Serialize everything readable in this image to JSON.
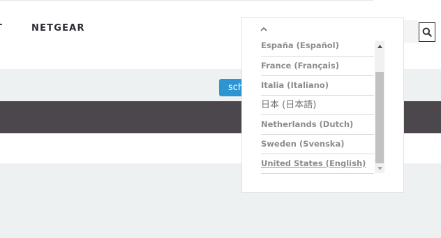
{
  "nav": {
    "cut_item": "T",
    "brand_item": "NETGEAR"
  },
  "search": {
    "placeholder": "",
    "button_icon": "search-icon"
  },
  "hero": {
    "button_label": "sch"
  },
  "language_dropdown": {
    "toggle_icon": "chevron-up-icon",
    "items": [
      {
        "label": "España (Español)"
      },
      {
        "label": "France (Français)"
      },
      {
        "label": "Italia (Italiano)"
      },
      {
        "label": "日本 (日本語)"
      },
      {
        "label": "Netherlands (Dutch)"
      },
      {
        "label": "Sweden (Svenska)"
      },
      {
        "label": "United States (English)"
      }
    ],
    "selected": "United States (English)"
  },
  "colors": {
    "accent_blue": "#2e95d3",
    "dark_band": "#4b474d",
    "light_band": "#eef1f2"
  }
}
